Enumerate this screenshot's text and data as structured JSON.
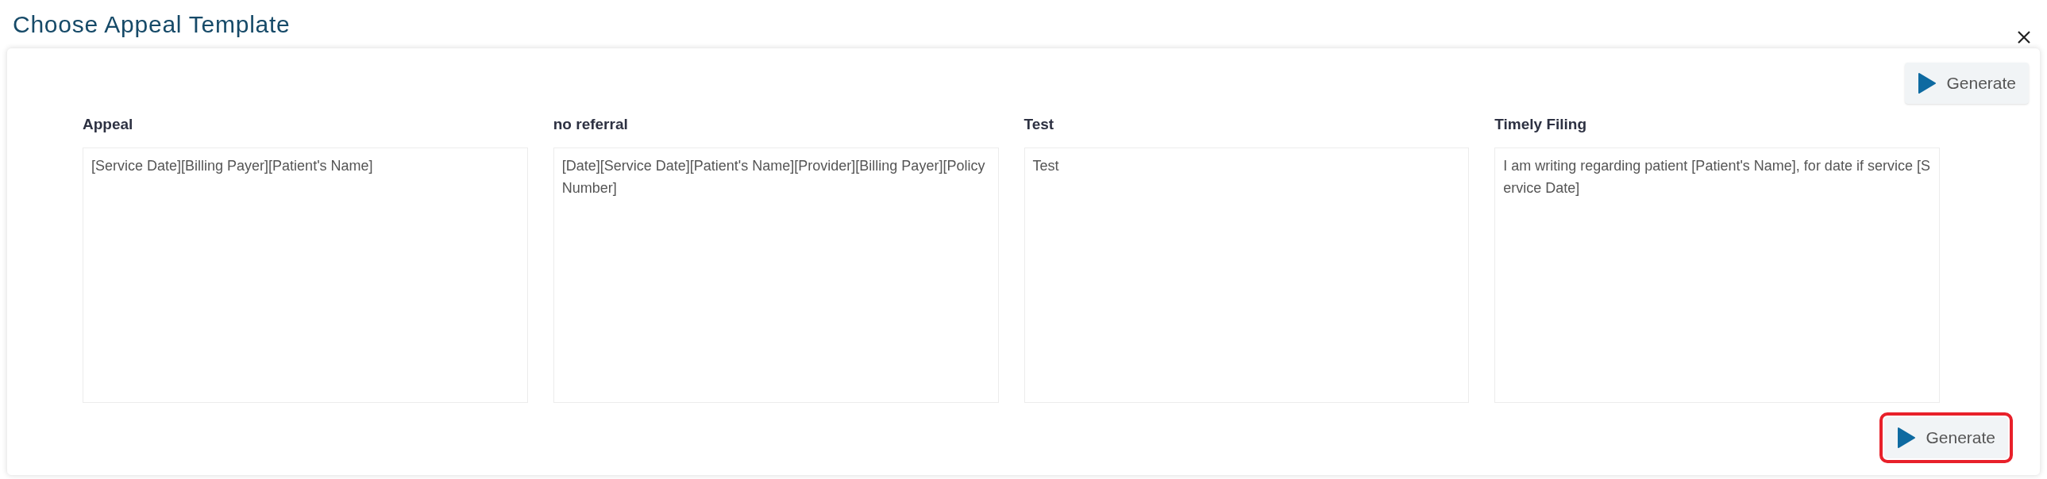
{
  "dialog": {
    "title": "Choose Appeal Template"
  },
  "top_button": {
    "label": "Generate",
    "highlighted": false
  },
  "templates": [
    {
      "name": "Appeal",
      "text": "[Service Date][Billing Payer][Patient's Name]"
    },
    {
      "name": "no referral",
      "text": "[Date][Service Date][Patient's Name][Provider][Billing Payer][Policy Number]"
    },
    {
      "name": "Test",
      "text": "Test"
    },
    {
      "name": "Timely Filing",
      "text": "I am writing regarding patient [Patient's Name], for date if service [Service Date]"
    }
  ],
  "bottom_button": {
    "label": "Generate",
    "highlighted": true
  }
}
